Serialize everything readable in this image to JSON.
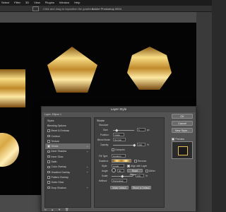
{
  "menubar": {
    "items": [
      "Select",
      "Filter",
      "3D",
      "View",
      "Plugins",
      "Window",
      "Help"
    ]
  },
  "options_bar": {
    "hint": "Click and drag to reposition the gradient",
    "app_title": "Adobe Photoshop 2024"
  },
  "colors": {
    "accent": "#e3bc53",
    "canvas": "#040404",
    "workspace": "#4a4a4a",
    "dialog_bg": "#535353"
  },
  "dialog": {
    "title": "Layer Style",
    "layer_name": "Layer: Ellipse 1",
    "styles_header": "Styles",
    "blending_options": "Blending Options",
    "effects": [
      {
        "label": "Bevel & Emboss",
        "checked": false,
        "plus": false
      },
      {
        "label": "Contour",
        "checked": false,
        "plus": false
      },
      {
        "label": "Texture",
        "checked": false,
        "plus": false
      },
      {
        "label": "Stroke",
        "checked": true,
        "plus": true,
        "selected": true
      },
      {
        "label": "Inner Shadow",
        "checked": false,
        "plus": true
      },
      {
        "label": "Inner Glow",
        "checked": false,
        "plus": false
      },
      {
        "label": "Satin",
        "checked": false,
        "plus": false
      },
      {
        "label": "Color Overlay",
        "checked": false,
        "plus": true
      },
      {
        "label": "Gradient Overlay",
        "checked": false,
        "plus": true
      },
      {
        "label": "Pattern Overlay",
        "checked": false,
        "plus": false
      },
      {
        "label": "Outer Glow",
        "checked": false,
        "plus": false
      },
      {
        "label": "Drop Shadow",
        "checked": false,
        "plus": true
      }
    ],
    "bottom_icons": [
      "fx-icon",
      "up-arrow-icon",
      "down-arrow-icon",
      "trash-icon"
    ],
    "stroke": {
      "section_title": "Stroke",
      "structure_title": "Structure",
      "size_label": "Size:",
      "size_value": "5",
      "size_unit": "px",
      "position_label": "Position:",
      "position_value": "Inside",
      "blend_mode_label": "Blend Mode:",
      "blend_mode_value": "Normal",
      "opacity_label": "Opacity:",
      "opacity_value": "100",
      "opacity_unit": "%",
      "overprint_label": "Overprint",
      "fill_type_label": "Fill Type:",
      "fill_type_value": "Gradient",
      "gradient_label": "Gradient:",
      "reverse_label": "Reverse",
      "style_label": "Style:",
      "style_value": "Linear",
      "align_label": "Align with Layer",
      "angle_label": "Angle:",
      "angle_value": "90",
      "reset_align_label": "Reset Alignment",
      "dither_label": "Dither",
      "scale_label": "Scale:",
      "scale_value": "100",
      "scale_unit": "%",
      "method_label": "Method:",
      "method_value": "Perceptual",
      "make_default": "Make Default",
      "reset_default": "Reset to Default"
    },
    "buttons": {
      "ok": "OK",
      "cancel": "Cancel",
      "new_style": "New Style...",
      "preview": "Preview"
    }
  }
}
